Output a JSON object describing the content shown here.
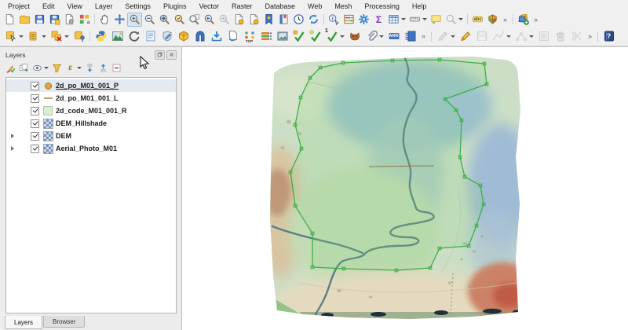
{
  "menu": {
    "items": [
      "Project",
      "Edit",
      "View",
      "Layer",
      "Settings",
      "Plugins",
      "Vector",
      "Raster",
      "Database",
      "Web",
      "Mesh",
      "Processing",
      "Help"
    ]
  },
  "toolbars": {
    "main": [
      {
        "name": "project-new",
        "sym": "page"
      },
      {
        "name": "project-open",
        "sym": "folder"
      },
      {
        "name": "project-save",
        "sym": "floppy"
      },
      {
        "name": "project-save-as",
        "sym": "floppy-badge"
      },
      {
        "name": "project-properties",
        "sym": "page-wrench"
      },
      {
        "name": "style-manager",
        "sym": "style"
      },
      {
        "sep": true
      },
      {
        "name": "pan-map",
        "sym": "hand"
      },
      {
        "name": "pan-to-selection",
        "sym": "move"
      },
      {
        "name": "zoom-in",
        "sym": "mag-plus",
        "active": true
      },
      {
        "name": "zoom-out",
        "sym": "mag-minus"
      },
      {
        "name": "zoom-full-extent",
        "sym": "mag-full"
      },
      {
        "name": "zoom-to-selection",
        "sym": "mag-sel"
      },
      {
        "name": "zoom-to-layer",
        "sym": "mag-layer"
      },
      {
        "name": "zoom-last",
        "sym": "mag-last"
      },
      {
        "name": "zoom-next",
        "sym": "mag-next",
        "grayed": true
      },
      {
        "name": "new-map-view",
        "sym": "page-badge"
      },
      {
        "name": "new-3d-map-view",
        "sym": "page-badge"
      },
      {
        "name": "new-spatial-bookmark",
        "sym": "bookmark"
      },
      {
        "name": "show-bookmarks",
        "sym": "book"
      },
      {
        "name": "temporal-controller",
        "sym": "clock"
      },
      {
        "name": "refresh-map",
        "sym": "refresh"
      },
      {
        "sep": true
      },
      {
        "name": "identify-features",
        "sym": "identify"
      },
      {
        "name": "statistical-summary",
        "sym": "abacus"
      },
      {
        "name": "processing-toolbox",
        "sym": "gear"
      },
      {
        "name": "show-statistics",
        "sym": "none",
        "glyph": "Σ",
        "gclass": "sigma"
      },
      {
        "name": "open-attribute-table",
        "sym": "table",
        "dd": true
      },
      {
        "name": "measure-line",
        "sym": "ruler",
        "dd": true
      },
      {
        "name": "map-tips",
        "sym": "bubble"
      },
      {
        "name": "locator-search",
        "sym": "mag",
        "grayed": true,
        "dd": true
      },
      {
        "sep": true
      },
      {
        "name": "layer-labeling",
        "sym": "tag",
        "glyph": "abc",
        "gclass": "abc"
      },
      {
        "name": "data-source-manager",
        "sym": "cube3d"
      },
      {
        "overflow": "»"
      },
      {
        "sep": true
      },
      {
        "name": "manage-layers",
        "sym": "layers-add"
      },
      {
        "overflow": "»"
      }
    ],
    "secondary": [
      {
        "name": "select-features",
        "sym": "select-rect",
        "dd": true
      },
      {
        "name": "select-features-by-value",
        "sym": "select-form",
        "dd": true
      },
      {
        "name": "deselect-features",
        "sym": "deselect",
        "dd": true
      },
      {
        "name": "select-by-location",
        "sym": "select-pin"
      },
      {
        "sep": true
      },
      {
        "name": "python-console",
        "sym": "python"
      },
      {
        "name": "plugin-terrain",
        "sym": "mountain"
      },
      {
        "name": "plugin-reload",
        "sym": "circ-arrow"
      },
      {
        "name": "plugin-notes",
        "sym": "blue-notes"
      },
      {
        "name": "plugin-style-check",
        "sym": "shield-pen"
      },
      {
        "name": "plugin-box",
        "sym": "cube-yellow"
      },
      {
        "name": "plugin-arch",
        "sym": "arch"
      },
      {
        "name": "plugin-download",
        "sym": "download"
      },
      {
        "name": "plugin-convert",
        "sym": "page-arrow"
      },
      {
        "name": "plugin-tcp",
        "sym": "tcp",
        "glyph": "TCP",
        "gclass": "tcp"
      },
      {
        "name": "plugin-profile-stack",
        "sym": "stack"
      },
      {
        "name": "plugin-screenshot",
        "sym": "image"
      },
      {
        "name": "check-digitizing",
        "sym": "check-pencil"
      },
      {
        "name": "check-review",
        "sym": "check-badge"
      },
      {
        "name": "check-topology",
        "sym": "check-one",
        "glyph": "1",
        "gclass": "one",
        "dd": true
      },
      {
        "name": "plugin-fox",
        "sym": "fox"
      },
      {
        "name": "attachments",
        "sym": "clip",
        "dd": true
      },
      {
        "name": "plugin-arr",
        "sym": "arr",
        "glyph": "ARR",
        "gclass": "arr"
      },
      {
        "name": "plugin-report",
        "sym": "blue-doc"
      },
      {
        "overflow": "»"
      },
      {
        "sep": true
      },
      {
        "name": "current-edits",
        "sym": "pencil-gray",
        "grayed": true,
        "dd": true
      },
      {
        "name": "toggle-editing",
        "sym": "pencil-yellow"
      },
      {
        "name": "save-layer-edits",
        "sym": "floppy-gray",
        "grayed": true
      },
      {
        "name": "add-feature",
        "sym": "add-line",
        "grayed": true,
        "dd": true
      },
      {
        "name": "vertex-tool",
        "sym": "vertex",
        "grayed": true,
        "dd": true
      },
      {
        "name": "modify-attributes",
        "sym": "edit-attr",
        "grayed": true
      },
      {
        "name": "delete-selected",
        "sym": "trash",
        "grayed": true
      },
      {
        "name": "cut-features",
        "sym": "scissors",
        "grayed": true
      },
      {
        "overflow": "»"
      },
      {
        "sep": true
      },
      {
        "name": "help-contents",
        "sym": "help-book",
        "glyph": "?",
        "gclass": "q"
      }
    ]
  },
  "layers_panel": {
    "title": "Layers",
    "toolbar": [
      {
        "name": "open-layer-styling",
        "sym": "brush"
      },
      {
        "name": "add-group",
        "sym": "add-group"
      },
      {
        "name": "manage-map-themes",
        "sym": "eye",
        "dd": true
      },
      {
        "name": "filter-legend",
        "sym": "funnel"
      },
      {
        "name": "filter-by-expression",
        "sym": "none",
        "glyph": "ε",
        "gclass": "eps",
        "dd": true
      },
      {
        "name": "expand-all",
        "sym": "expand-all"
      },
      {
        "name": "collapse-all",
        "sym": "collapse-all"
      },
      {
        "name": "remove-layer",
        "sym": "remove-box"
      }
    ],
    "layers": [
      {
        "name": "2d_po_M01_001_P",
        "symbol": "point",
        "checked": true,
        "selected": true,
        "underlined": true,
        "expandable": false
      },
      {
        "name": "2d_po_M01_001_L",
        "symbol": "line",
        "checked": true,
        "selected": false,
        "underlined": false,
        "expandable": false
      },
      {
        "name": "2d_code_M01_001_R",
        "symbol": "polygon",
        "checked": true,
        "selected": false,
        "underlined": false,
        "expandable": false
      },
      {
        "name": "DEM_Hillshade",
        "symbol": "raster",
        "checked": true,
        "selected": false,
        "underlined": false,
        "expandable": false
      },
      {
        "name": "DEM",
        "symbol": "raster",
        "checked": true,
        "selected": false,
        "underlined": false,
        "expandable": true
      },
      {
        "name": "Aerial_Photo_M01",
        "symbol": "raster",
        "checked": true,
        "selected": false,
        "underlined": false,
        "expandable": true
      }
    ],
    "tabs": [
      {
        "label": "Layers",
        "active": true
      },
      {
        "label": "Browser",
        "active": false
      }
    ]
  },
  "colors": {
    "selection_row": "#e4eaf0",
    "active_tool_bg": "#d6e4f2",
    "polygon_outline": "#3fae46",
    "stream": "#48707c",
    "window_bg": "#f0f0f0"
  }
}
